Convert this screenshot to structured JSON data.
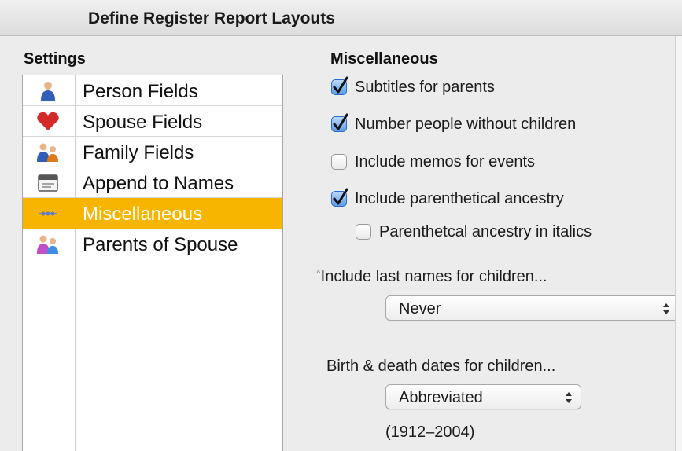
{
  "window": {
    "title": "Define Register Report Layouts"
  },
  "settings": {
    "header": "Settings",
    "items": [
      {
        "label": "Person Fields",
        "icon": "person-icon",
        "selected": false
      },
      {
        "label": "Spouse Fields",
        "icon": "heart-icon",
        "selected": false
      },
      {
        "label": "Family Fields",
        "icon": "family-icon",
        "selected": false
      },
      {
        "label": "Append to Names",
        "icon": "name-tag-icon",
        "selected": false
      },
      {
        "label": "Miscellaneous",
        "icon": "misc-icon",
        "selected": true
      },
      {
        "label": "Parents of Spouse",
        "icon": "parents-icon",
        "selected": false
      }
    ]
  },
  "misc": {
    "header": "Miscellaneous",
    "options": [
      {
        "label": "Subtitles for parents",
        "checked": true
      },
      {
        "label": "Number people without children",
        "checked": true
      },
      {
        "label": "Include memos for events",
        "checked": false
      },
      {
        "label": "Include parenthetical ancestry",
        "checked": true
      },
      {
        "label": "Parenthetcal ancestry in italics",
        "checked": false
      }
    ],
    "last_names": {
      "label": "Include last names for children...",
      "value": "Never"
    },
    "dates": {
      "label": "Birth & death dates for children...",
      "value": "Abbreviated",
      "example": "(1912–2004)"
    }
  },
  "colors": {
    "selection": "#f7b500",
    "checkbox_checked": "#5b9ce8"
  }
}
